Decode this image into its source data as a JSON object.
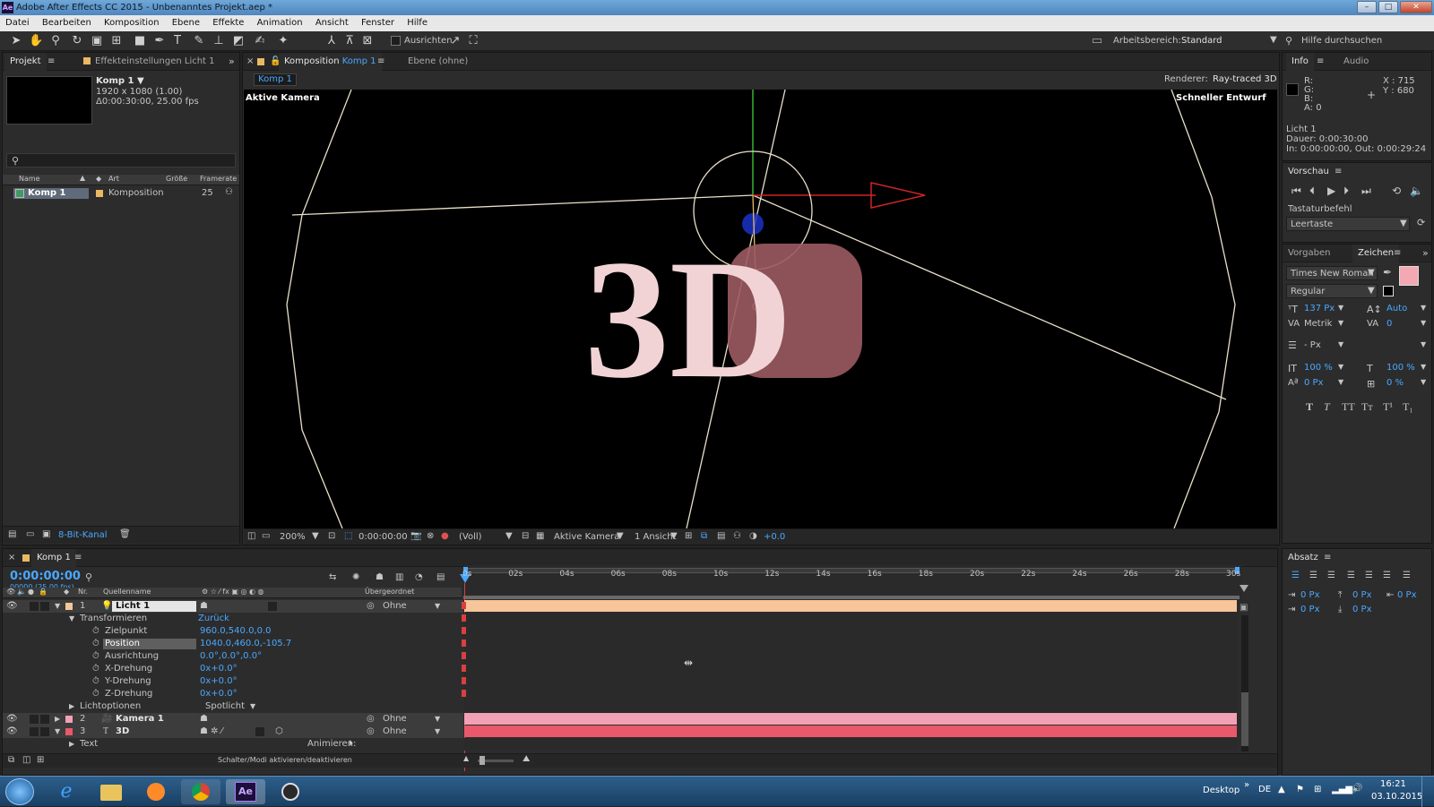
{
  "app": {
    "title": "Adobe After Effects CC 2015 - Unbenanntes Projekt.aep *",
    "icon_text": "Ae"
  },
  "menu": [
    "Datei",
    "Bearbeiten",
    "Komposition",
    "Ebene",
    "Effekte",
    "Animation",
    "Ansicht",
    "Fenster",
    "Hilfe"
  ],
  "toolbar": {
    "align_label": "Ausrichten",
    "workspace_label": "Arbeitsbereich:",
    "workspace_value": "Standard",
    "search_help": "Hilfe durchsuchen"
  },
  "project": {
    "tab_project": "Projekt",
    "tab_effects": "Effekteinstellungen Licht 1",
    "comp_name": "Komp 1 ▼",
    "comp_size": "1920 x 1080 (1.00)",
    "comp_duration": "Δ0:00:30:00, 25.00 fps",
    "columns": {
      "name": "Name",
      "type": "Art",
      "size": "Größe",
      "framerate": "Framerate"
    },
    "items": [
      {
        "name": "Komp 1",
        "type": "Komposition",
        "framerate": "25"
      }
    ],
    "bit_depth": "8-Bit-Kanal"
  },
  "comp_panel": {
    "tab_prefix": "Komposition",
    "tab_comp": "Komp 1",
    "tab_layer": "Ebene (ohne)",
    "subtab": "Komp 1",
    "renderer_label": "Renderer:",
    "renderer_value": "Ray-traced 3D",
    "camera_label": "Aktive Kamera",
    "draft_label": "Schneller Entwurf",
    "text_3d": "3D",
    "footer": {
      "zoom": "200%",
      "timecode": "0:00:00:00",
      "resolution": "(Voll)",
      "camera": "Aktive Kamera",
      "views": "1 Ansicht",
      "exposure": "+0.0"
    }
  },
  "info": {
    "tab_info": "Info",
    "tab_audio": "Audio",
    "r": "R:",
    "g": "G:",
    "b": "B:",
    "a": "A:  0",
    "x": "X : 715",
    "y": "Y : 680",
    "layer": "Licht 1",
    "duration": "Dauer: 0:00:30:00",
    "inout": "In: 0:00:00:00, Out: 0:00:29:24"
  },
  "preview": {
    "title": "Vorschau",
    "shortcut_label": "Tastaturbefehl",
    "shortcut_value": "Leertaste"
  },
  "character": {
    "tab_presets": "Vorgaben",
    "tab_character": "Zeichen",
    "font": "Times New Roman",
    "style": "Regular",
    "size": "137 Px",
    "leading": "Auto",
    "kerning": "Metrik",
    "tracking": "0",
    "stroke": "- Px",
    "vscale": "100 %",
    "hscale": "100 %",
    "baseline": "0 Px",
    "tsume": "0 %",
    "fill_color": "#f4a8b4"
  },
  "paragraph": {
    "title": "Absatz",
    "v1": "0 Px",
    "v2": "0 Px",
    "v3": "0 Px",
    "v4": "0 Px",
    "v5": "0 Px"
  },
  "timeline": {
    "tab": "Komp 1",
    "timecode": "0:00:00:00",
    "fps": "00000 (25.00 fps)",
    "columns": {
      "nr": "Nr.",
      "source": "Quellenname",
      "parent": "Übergeordnet"
    },
    "ruler": [
      "0s",
      "02s",
      "04s",
      "06s",
      "08s",
      "10s",
      "12s",
      "14s",
      "16s",
      "18s",
      "20s",
      "22s",
      "24s",
      "26s",
      "28s",
      "30s"
    ],
    "layer1": {
      "nr": "1",
      "name": "Licht 1",
      "parent": "Ohne"
    },
    "transform": {
      "label": "Transformieren",
      "reset": "Zurück"
    },
    "props": [
      {
        "name": "Zielpunkt",
        "value": "960.0,540.0,0.0"
      },
      {
        "name": "Position",
        "value": "1040.0,460.0,-105.7"
      },
      {
        "name": "Ausrichtung",
        "value": "0.0°,0.0°,0.0°"
      },
      {
        "name": "X-Drehung",
        "value": "0x+0.0°"
      },
      {
        "name": "Y-Drehung",
        "value": "0x+0.0°"
      },
      {
        "name": "Z-Drehung",
        "value": "0x+0.0°"
      }
    ],
    "light_options": {
      "label": "Lichtoptionen",
      "value": "Spotlicht"
    },
    "layer2": {
      "nr": "2",
      "name": "Kamera 1",
      "parent": "Ohne"
    },
    "layer3": {
      "nr": "3",
      "name": "3D",
      "parent": "Ohne"
    },
    "text_group": "Text",
    "animate": "Animieren:",
    "toggle_modes": "Schalter/Modi aktivieren/deaktivieren"
  },
  "taskbar": {
    "desktop": "Desktop",
    "lang": "DE",
    "time": "16:21",
    "date": "03.10.2015"
  },
  "colors": {
    "accent": "#4aa8ff",
    "light_bar": "#f7c59a",
    "camera_bar": "#f2a1b4",
    "text_bar": "#e8596c"
  }
}
